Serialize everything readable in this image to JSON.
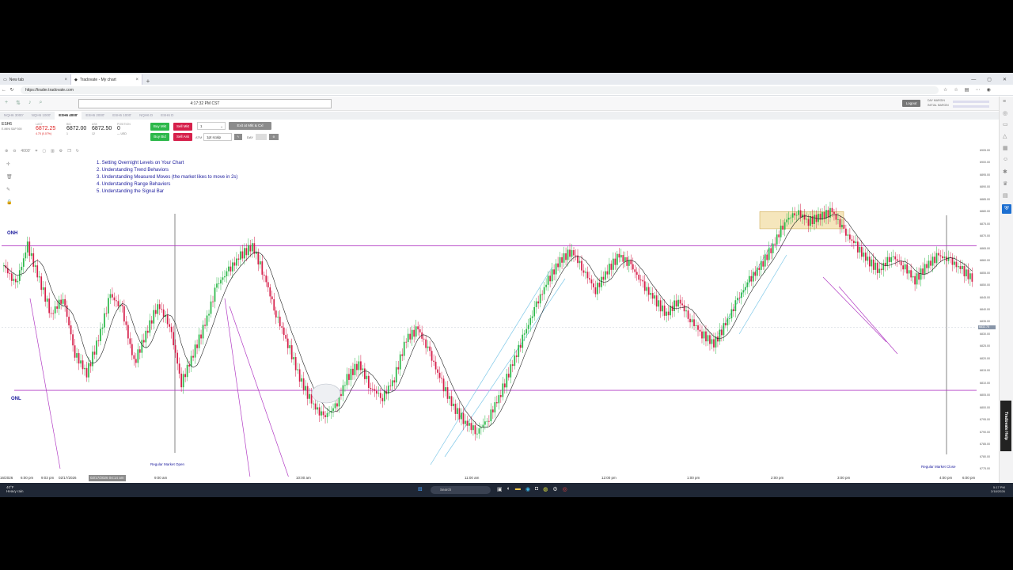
{
  "browser": {
    "tabs": [
      {
        "title": "New tab",
        "active": false
      },
      {
        "title": "Tradovate - My chart",
        "active": true
      }
    ],
    "url": "https://trader.tradovate.com"
  },
  "app": {
    "clock": "4:17:32 PM CST",
    "logout_label": "Logout",
    "margin_labels": [
      "DAY MARGIN",
      "INITIAL MARGIN"
    ],
    "contract_tabs": [
      "NQH6 3000'",
      "NQH6 1000'",
      "ESH6 4000'",
      "ESH6 2000'",
      "ESH6 1000'",
      "NQH6 D",
      "ESH6 D"
    ],
    "active_contract_tab": 2
  },
  "quote": {
    "symbol": "ESH6",
    "symbol_desc": "E-MINI S&P 500",
    "last_label": "LAST",
    "last": "6872.25",
    "change": "4.75 (0.07%)",
    "bid_label": "BID",
    "bid": "6872.00",
    "bid_size": "1",
    "ask_label": "ASK",
    "ask": "6872.50",
    "ask_size": "12",
    "position_label": "POSITION",
    "position": "0",
    "position_sub": "— USD"
  },
  "orders": {
    "buy_mkt": "Buy Mkt",
    "sell_mkt": "Sell Mkt",
    "buy_bid": "Buy Bid",
    "sell_ask": "Sell Ask",
    "qty": "1",
    "exit_label": "Exit at Mkt & Cxl",
    "atm_label": "ATM",
    "atm_value": "1pt scalp",
    "tif": "DAY"
  },
  "chart": {
    "toolbar_value": "4000'",
    "notes": [
      "1.  Setting Overnight Levels on Your Chart",
      "2.  Understanding Trend Behaviors",
      "3.  Understanding Measured Moves (the market likes to move in 2s)",
      "4.  Understanding Range Behaviors",
      "5.  Understanding the Signal Bar"
    ],
    "onh_label": "ONH",
    "onl_label": "ONL",
    "regular_open": "Regular Market Open",
    "regular_close": "Regular Market Close",
    "last_price_tag": "6832.75",
    "x_labels": [
      "16/2026",
      "6:00 pm",
      "9:03 pm",
      "02/17/2026",
      "9:00 am",
      "10:00 am",
      "11:00 am",
      "12:00 pm",
      "1:00 pm",
      "2:00 pm",
      "3:00 pm",
      "4:00 pm",
      "6:00 pm"
    ],
    "x_cursor": "02/17/2026 04:14 am",
    "colors": {
      "up": "#2db84a",
      "down": "#d6204b",
      "level": "#b23cc4",
      "trend": "#b23cc4",
      "channel": "#3cc4b8",
      "range": "#e8c86a",
      "notes": "#1a1a9c"
    }
  },
  "chart_data": {
    "type": "candlestick",
    "title": "",
    "symbol": "ESH6",
    "ylim": [
      6775,
      6905
    ],
    "y_ticks": [
      6905,
      6900,
      6895,
      6890,
      6885,
      6880,
      6875,
      6870,
      6865,
      6860,
      6855,
      6850,
      6845,
      6840,
      6835,
      6830,
      6825,
      6820,
      6815,
      6810,
      6805,
      6800,
      6795,
      6790,
      6785,
      6780,
      6775
    ],
    "onh": 6866,
    "onl": 6807,
    "last": 6832.75,
    "price_path": [
      6858,
      6850,
      6866,
      6852,
      6838,
      6845,
      6822,
      6814,
      6828,
      6846,
      6840,
      6818,
      6830,
      6842,
      6834,
      6810,
      6822,
      6834,
      6850,
      6856,
      6862,
      6866,
      6854,
      6838,
      6826,
      6812,
      6802,
      6796,
      6800,
      6812,
      6818,
      6808,
      6804,
      6812,
      6828,
      6832,
      6822,
      6810,
      6800,
      6794,
      6790,
      6796,
      6806,
      6818,
      6830,
      6842,
      6852,
      6860,
      6864,
      6856,
      6848,
      6856,
      6862,
      6858,
      6850,
      6844,
      6838,
      6844,
      6836,
      6830,
      6826,
      6834,
      6844,
      6852,
      6858,
      6866,
      6876,
      6880,
      6876,
      6878,
      6880,
      6872,
      6866,
      6860,
      6856,
      6862,
      6858,
      6852,
      6858,
      6862,
      6860,
      6856,
      6852
    ]
  },
  "taskbar": {
    "temp": "40°F",
    "weather": "Heavy rain",
    "search_placeholder": "Search",
    "time": "5:17 PM",
    "date": "2/18/2026"
  },
  "sidebar": {
    "help_label": "Tradovate Help"
  }
}
